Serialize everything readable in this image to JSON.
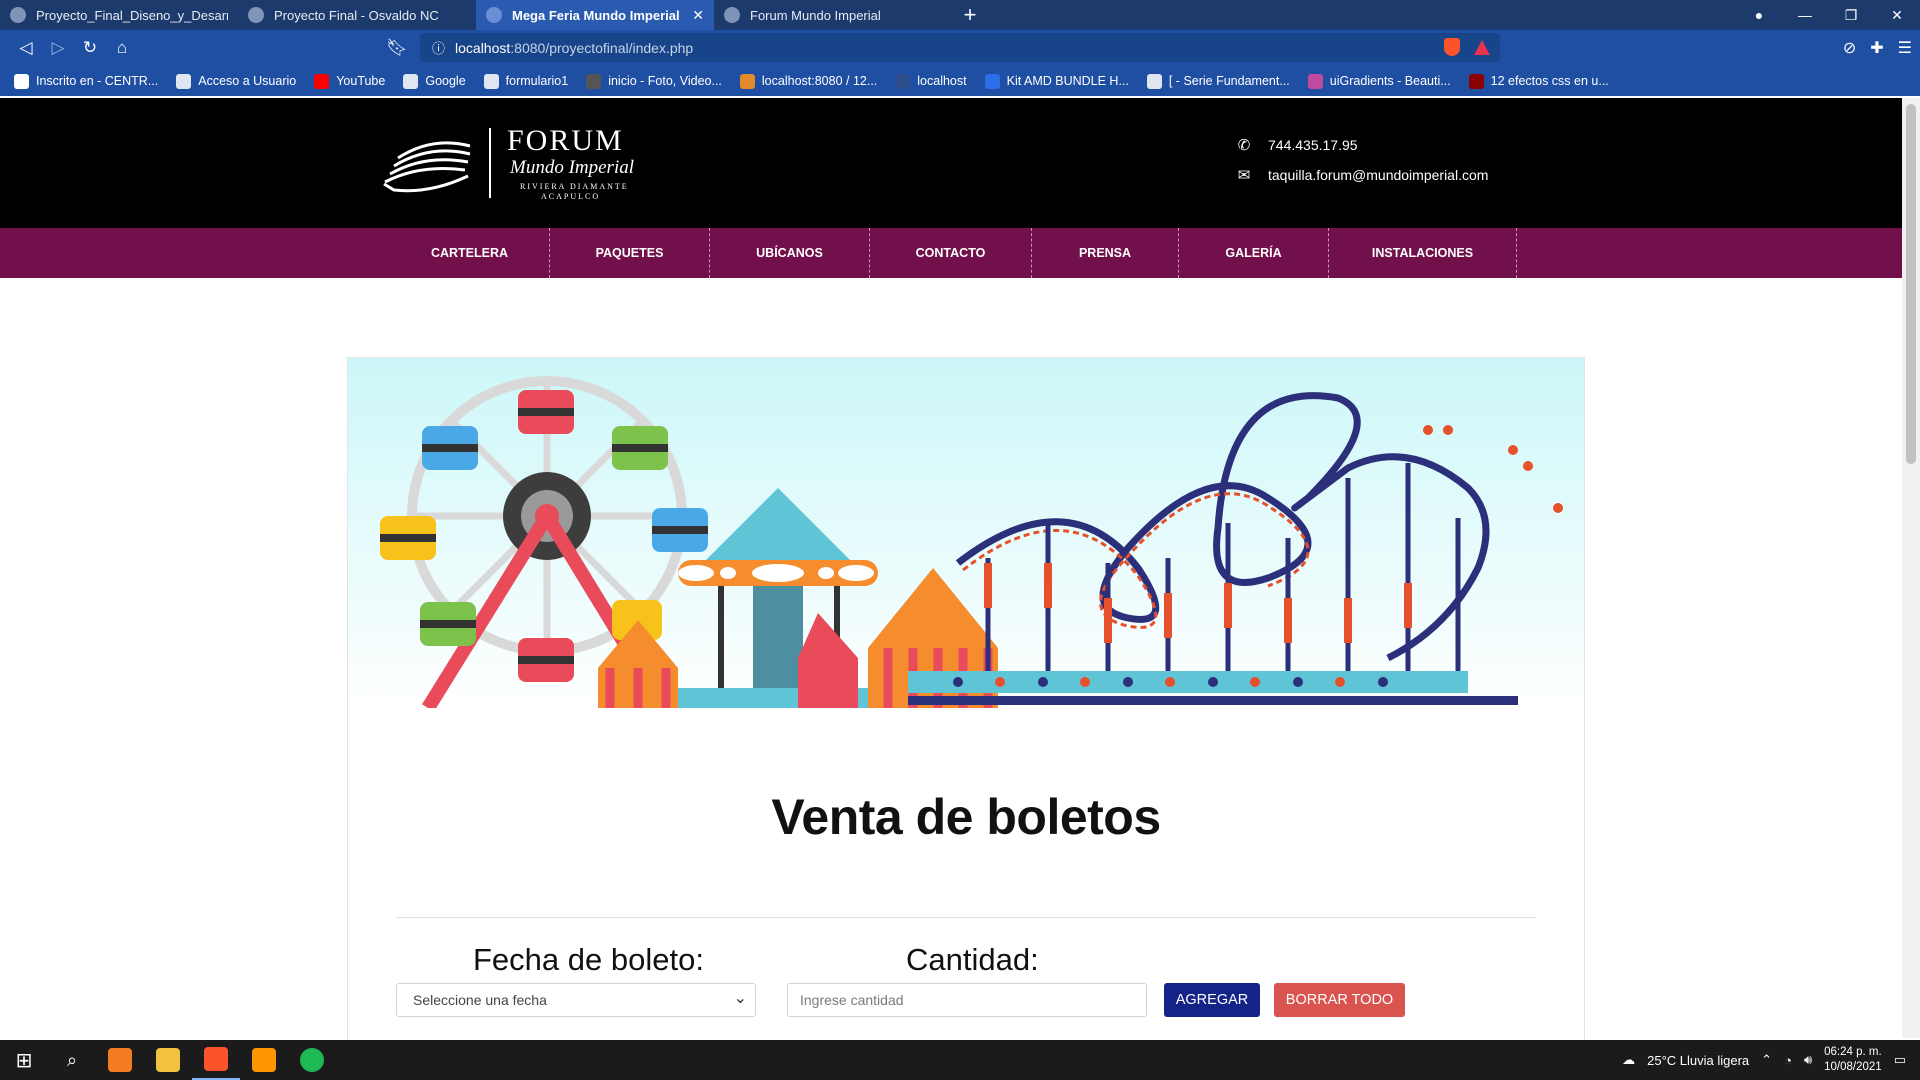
{
  "browser": {
    "tabs": [
      {
        "title": "Proyecto_Final_Diseno_y_Desarrollo_C",
        "active": false
      },
      {
        "title": "Proyecto Final - Osvaldo NC",
        "active": false
      },
      {
        "title": "Mega Feria Mundo Imperial",
        "active": true
      },
      {
        "title": "Forum Mundo Imperial",
        "active": false
      }
    ],
    "new_tab": "+",
    "url_host": "localhost",
    "url_path": ":8080/proyectofinal/index.php",
    "bookmarks": [
      {
        "label": "Inscrito en - CENTR...",
        "color": "#ffffff"
      },
      {
        "label": "Acceso a Usuario",
        "color": "#dfe6f2"
      },
      {
        "label": "YouTube",
        "color": "#ff0000"
      },
      {
        "label": "Google",
        "color": "#dfe6f2"
      },
      {
        "label": "formulario1",
        "color": "#dfe6f2"
      },
      {
        "label": "inicio - Foto, Video...",
        "color": "#555555"
      },
      {
        "label": "localhost:8080 / 12...",
        "color": "#e38a2b"
      },
      {
        "label": "localhost",
        "color": "#2b4d8c"
      },
      {
        "label": "Kit AMD BUNDLE H...",
        "color": "#2b6ee8"
      },
      {
        "label": "[ - Serie Fundament...",
        "color": "#dfe6f2"
      },
      {
        "label": "uiGradients - Beauti...",
        "color": "#c04a9e"
      },
      {
        "label": "12 efectos css en u...",
        "color": "#8b0000"
      }
    ]
  },
  "site": {
    "logo": {
      "name": "FORUM",
      "script": "Mundo Imperial",
      "tagline1": "RIVIERA DIAMANTE",
      "tagline2": "ACAPULCO"
    },
    "phone": "744.435.17.95",
    "email": "taquilla.forum@mundoimperial.com",
    "menu": [
      "CARTELERA",
      "PAQUETES",
      "UBÍCANOS",
      "CONTACTO",
      "PRENSA",
      "GALERÍA",
      "INSTALACIONES"
    ]
  },
  "main": {
    "title": "Venta de boletos",
    "date_label": "Fecha de boleto:",
    "date_select_value": "Seleccione una fecha",
    "qty_label": "Cantidad:",
    "qty_placeholder": "Ingrese cantidad",
    "add_button": "AGREGAR",
    "clear_button": "BORRAR TODO"
  },
  "taskbar": {
    "weather": "25°C  Lluvia ligera",
    "time": "06:24 p. m.",
    "date": "10/08/2021"
  },
  "colors": {
    "menu_bg": "#71104a",
    "add_btn": "#132387",
    "clear_btn": "#d9534f",
    "browser_bar": "#1f4fa3"
  }
}
